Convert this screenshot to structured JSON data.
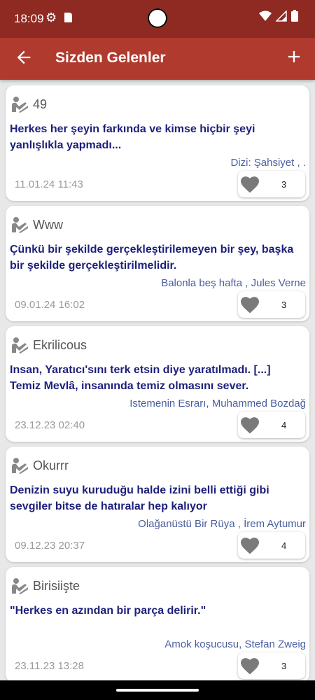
{
  "status": {
    "time": "18:09"
  },
  "appbar": {
    "title": "Sizden Gelenler"
  },
  "posts": [
    {
      "user": "49",
      "quote": "Herkes her şeyin farkında ve kimse hiçbir şeyi yanlışlıkla yapmadı...",
      "source": "Dizi: Şahsiyet , .",
      "date": "11.01.24 11:43",
      "likes": "3"
    },
    {
      "user": "Www",
      "quote": "Çünkü bir şekilde gerçekleştirilemeyen bir şey, başka bir şekilde gerçekleştirilmelidir.",
      "source": "Balonla beş hafta , Jules Verne",
      "date": "09.01.24 16:02",
      "likes": "3"
    },
    {
      "user": "Ekrilicous",
      "quote": "Insan, Yaratıcı'sını terk etsin diye yaratılmadı. [...] Temiz Mevlâ, insanında temiz olmasını sever.",
      "source": "Istemenin Esrarı, Muhammed Bozdağ",
      "date": "23.12.23 02:40",
      "likes": "4"
    },
    {
      "user": "Okurrr",
      "quote": "Denizin suyu kuruduğu halde izini belli ettiği gibi sevgiler bitse de hatıralar hep kalıyor",
      "source": "Olağanüstü Bir Rüya , İrem Aytumur",
      "date": "09.12.23 20:37",
      "likes": "4"
    },
    {
      "user": "Birisiişte",
      "quote": "\"Herkes en azından bir parça delirir.\"",
      "source": "Amok koşucusu, Stefan Zweig",
      "date": "23.11.23 13:28",
      "likes": "3"
    }
  ]
}
